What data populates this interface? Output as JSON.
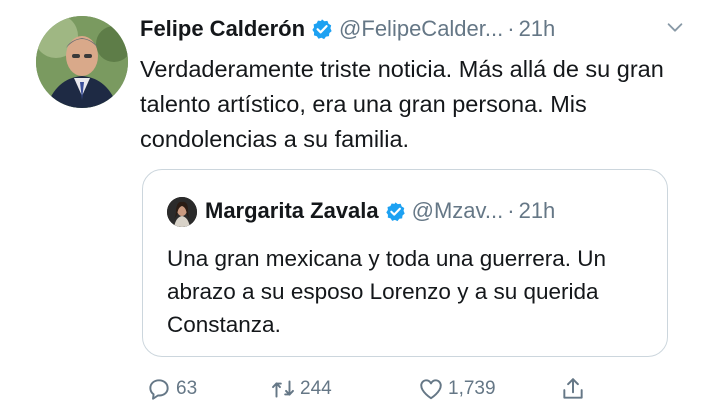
{
  "tweet": {
    "author_name": "Felipe Calderón",
    "handle": "@FelipeCalder...",
    "separator": "·",
    "time": "21h",
    "text": "Verdaderamente triste noticia. Más  allá de su gran talento artístico, era una gran persona. Mis condolencias a su familia."
  },
  "quoted_tweet": {
    "author_name": "Margarita Zavala",
    "handle": "@Mzav...",
    "separator": "·",
    "time": "21h",
    "text": "Una gran mexicana y toda una guerrera. Un abrazo a su esposo Lorenzo y a su querida Constanza."
  },
  "actions": {
    "reply_count": "63",
    "retweet_count": "244",
    "like_count": "1,739"
  },
  "icons": {
    "verified": "verified-badge-icon",
    "caret": "chevron-down-icon",
    "reply": "reply-icon",
    "retweet": "retweet-icon",
    "like": "heart-icon",
    "share": "share-icon"
  },
  "colors": {
    "text": "#14171a",
    "secondary": "#657786",
    "verified": "#1da1f2",
    "border": "#ccd6dd"
  }
}
